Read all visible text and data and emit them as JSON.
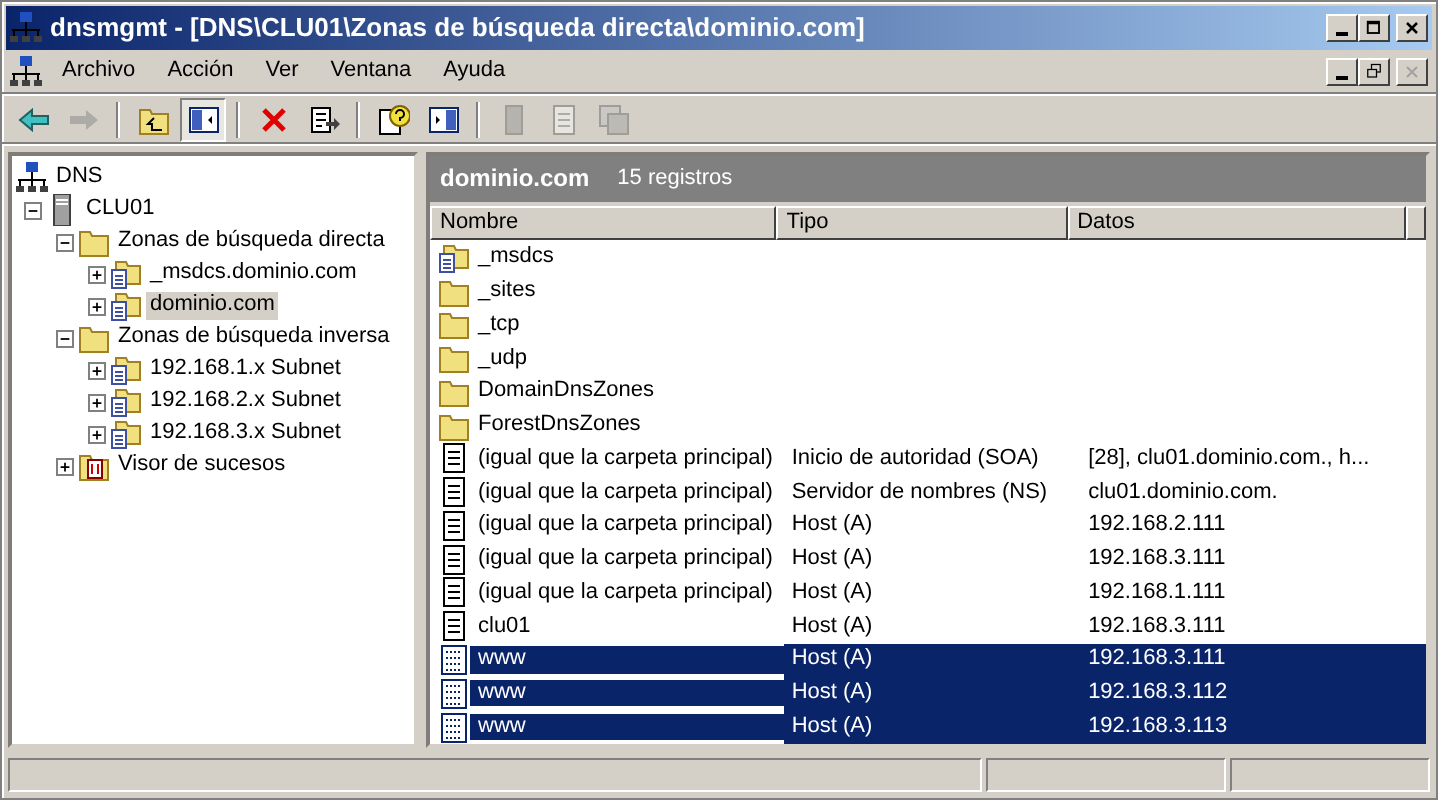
{
  "window": {
    "title": "dnsmgmt - [DNS\\CLU01\\Zonas de búsqueda directa\\dominio.com]"
  },
  "menu": [
    "Archivo",
    "Acción",
    "Ver",
    "Ventana",
    "Ayuda"
  ],
  "toolbar": [
    {
      "kind": "back",
      "disabled": false,
      "pressed": false
    },
    {
      "kind": "forward",
      "disabled": true,
      "pressed": false
    },
    {
      "kind": "sep"
    },
    {
      "kind": "up",
      "disabled": false,
      "pressed": false
    },
    {
      "kind": "tree",
      "disabled": false,
      "pressed": true
    },
    {
      "kind": "sep"
    },
    {
      "kind": "delete",
      "disabled": false,
      "pressed": false
    },
    {
      "kind": "export",
      "disabled": false,
      "pressed": false
    },
    {
      "kind": "sep"
    },
    {
      "kind": "help",
      "disabled": false,
      "pressed": false
    },
    {
      "kind": "pane",
      "disabled": false,
      "pressed": false
    },
    {
      "kind": "sep"
    },
    {
      "kind": "doc",
      "disabled": true,
      "pressed": false
    },
    {
      "kind": "note",
      "disabled": true,
      "pressed": false
    },
    {
      "kind": "copy",
      "disabled": true,
      "pressed": false
    }
  ],
  "tree": [
    {
      "label": "DNS",
      "kind": "network",
      "selected": false,
      "children": [
        {
          "label": "CLU01",
          "kind": "server",
          "expanded": true,
          "selected": false,
          "children": [
            {
              "label": "Zonas de búsqueda directa",
              "kind": "folder",
              "expanded": true,
              "selected": false,
              "children": [
                {
                  "label": "_msdcs.dominio.com",
                  "kind": "zone",
                  "expanded": false,
                  "selected": false
                },
                {
                  "label": "dominio.com",
                  "kind": "zone",
                  "expanded": false,
                  "selected": true
                }
              ]
            },
            {
              "label": "Zonas de búsqueda inversa",
              "kind": "folder",
              "expanded": true,
              "selected": false,
              "children": [
                {
                  "label": "192.168.1.x Subnet",
                  "kind": "zone",
                  "expanded": false,
                  "selected": false
                },
                {
                  "label": "192.168.2.x Subnet",
                  "kind": "zone",
                  "expanded": false,
                  "selected": false
                },
                {
                  "label": "192.168.3.x Subnet",
                  "kind": "zone",
                  "expanded": false,
                  "selected": false
                }
              ]
            },
            {
              "label": "Visor de sucesos",
              "kind": "events",
              "expanded": false,
              "selected": false
            }
          ]
        }
      ]
    }
  ],
  "pane": {
    "title": "dominio.com",
    "count": "15 registros"
  },
  "table": {
    "columns": [
      "Nombre",
      "Tipo",
      "Datos"
    ],
    "rows": [
      {
        "kind": "zone",
        "name": "_msdcs",
        "type": "",
        "data": "",
        "selected": false
      },
      {
        "kind": "folder",
        "name": "_sites",
        "type": "",
        "data": "",
        "selected": false
      },
      {
        "kind": "folder",
        "name": "_tcp",
        "type": "",
        "data": "",
        "selected": false
      },
      {
        "kind": "folder",
        "name": "_udp",
        "type": "",
        "data": "",
        "selected": false
      },
      {
        "kind": "folder",
        "name": "DomainDnsZones",
        "type": "",
        "data": "",
        "selected": false
      },
      {
        "kind": "folder",
        "name": "ForestDnsZones",
        "type": "",
        "data": "",
        "selected": false
      },
      {
        "kind": "record",
        "name": "(igual que la carpeta principal)",
        "type": "Inicio de autoridad (SOA)",
        "data": "[28], clu01.dominio.com., h...",
        "selected": false
      },
      {
        "kind": "record",
        "name": "(igual que la carpeta principal)",
        "type": "Servidor de nombres (NS)",
        "data": "clu01.dominio.com.",
        "selected": false
      },
      {
        "kind": "record",
        "name": "(igual que la carpeta principal)",
        "type": "Host (A)",
        "data": "192.168.2.111",
        "selected": false
      },
      {
        "kind": "record",
        "name": "(igual que la carpeta principal)",
        "type": "Host (A)",
        "data": "192.168.3.111",
        "selected": false
      },
      {
        "kind": "record",
        "name": "(igual que la carpeta principal)",
        "type": "Host (A)",
        "data": "192.168.1.111",
        "selected": false
      },
      {
        "kind": "record",
        "name": "clu01",
        "type": "Host (A)",
        "data": "192.168.3.111",
        "selected": false
      },
      {
        "kind": "record",
        "name": "www",
        "type": "Host (A)",
        "data": "192.168.3.111",
        "selected": true
      },
      {
        "kind": "record",
        "name": "www",
        "type": "Host (A)",
        "data": "192.168.3.112",
        "selected": true
      },
      {
        "kind": "record",
        "name": "www",
        "type": "Host (A)",
        "data": "192.168.3.113",
        "selected": true
      }
    ]
  }
}
